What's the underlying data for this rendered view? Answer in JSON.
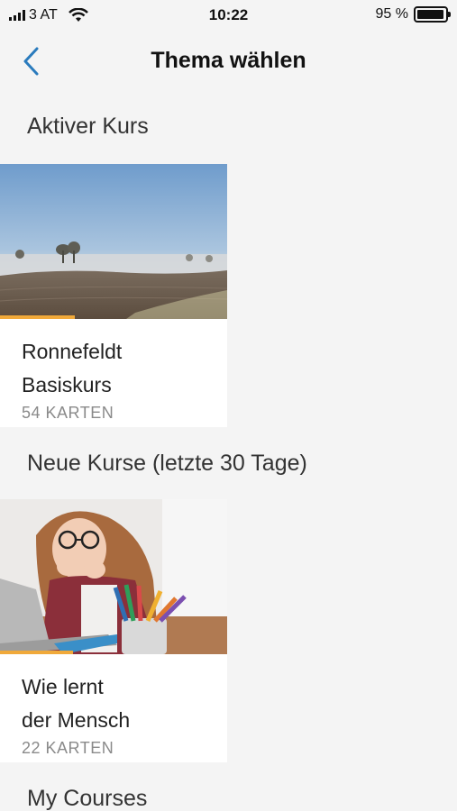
{
  "status": {
    "carrier": "3 AT",
    "time": "10:22",
    "battery_text": "95 %",
    "battery_level": 0.95
  },
  "nav": {
    "title": "Thema wählen"
  },
  "sections": {
    "active": "Aktiver Kurs",
    "new": "Neue Kurse (letzte 30 Tage)",
    "mine": "My Courses"
  },
  "cards": [
    {
      "title_line1": "Ronnefeldt",
      "title_line2": "Basiskurs",
      "count": "54 KARTEN",
      "progress": 0.33
    },
    {
      "title_line1": "Wie lernt",
      "title_line2": "der Mensch",
      "count": "22 KARTEN",
      "progress": 0.32
    }
  ],
  "colors": {
    "accent": "#2a7bbd",
    "progress": "#f0a93a"
  }
}
